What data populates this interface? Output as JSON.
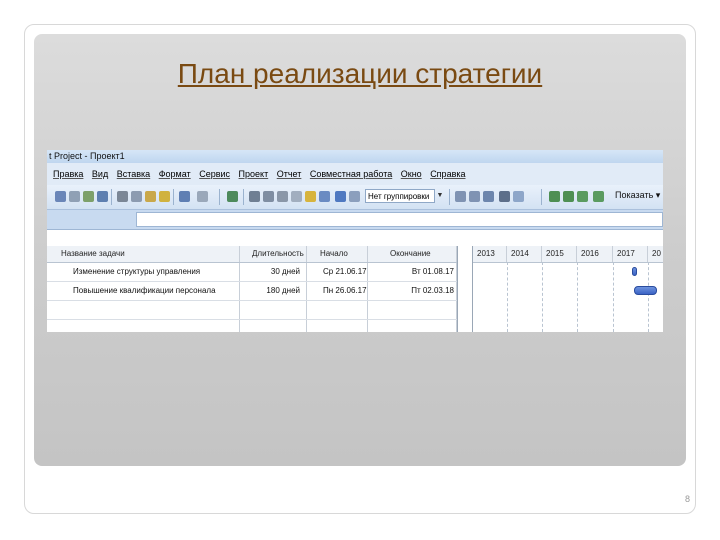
{
  "slide": {
    "title": "План реализации стратегии",
    "page_number": "8"
  },
  "window": {
    "title": "t Project - Проект1"
  },
  "menu": [
    "Правка",
    "Вид",
    "Вставка",
    "Формат",
    "Сервис",
    "Проект",
    "Отчет",
    "Совместная работа",
    "Окно",
    "Справка"
  ],
  "toolbar": {
    "group_combo_value": "Нет группировки",
    "show_label": "Показать"
  },
  "table": {
    "headers": [
      "Название задачи",
      "Длительность",
      "Начало",
      "Окончание"
    ],
    "rows": [
      {
        "name": "Изменение структуры управления",
        "duration": "30 дней",
        "start": "Ср 21.06.17",
        "end": "Вт 01.08.17"
      },
      {
        "name": "Повышение квалификации персонала",
        "duration": "180 дней",
        "start": "Пн 26.06.17",
        "end": "Пт 02.03.18"
      }
    ]
  },
  "gantt": {
    "years": [
      "2013",
      "2014",
      "2015",
      "2016",
      "2017",
      "20"
    ],
    "bar_color": "#4a6fd0"
  }
}
